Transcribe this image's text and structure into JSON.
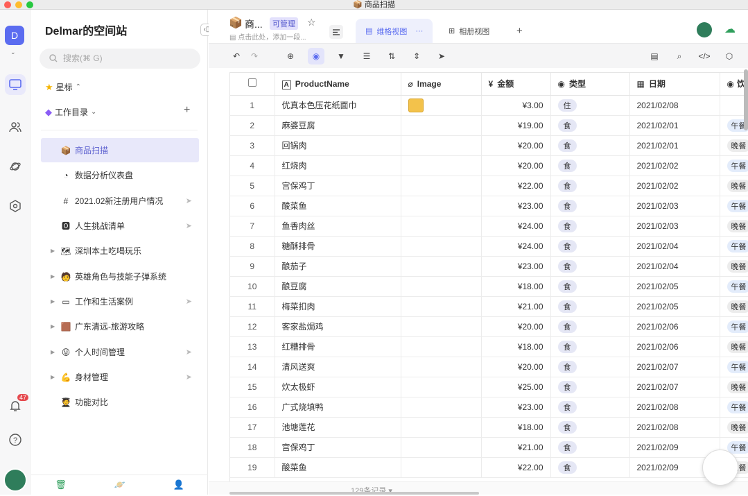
{
  "window": {
    "title": "📦 商品扫描"
  },
  "rail": {
    "workspace_initial": "D",
    "notification_count": "47"
  },
  "sidebar": {
    "title": "Delmar的空间站",
    "search_placeholder": "搜索(⌘ G)",
    "starred_label": "星标",
    "catalog_label": "工作目录",
    "items": [
      {
        "icon": "📦",
        "label": "商品扫描",
        "arrow": "",
        "active": true
      },
      {
        "icon": "◔",
        "label": "数据分析仪表盘",
        "arrow": ""
      },
      {
        "icon": "#",
        "label": "2021.02新注册用户情况",
        "arrow": ""
      },
      {
        "icon": "🅾",
        "label": "人生挑战清单",
        "arrow": ""
      },
      {
        "icon": "🗺",
        "label": "深圳本土吃喝玩乐",
        "arrow": "▶"
      },
      {
        "icon": "🧑",
        "label": "英雄角色与技能子弹系统",
        "arrow": "▶"
      },
      {
        "icon": "▭",
        "label": "工作和生活案例",
        "arrow": "▶"
      },
      {
        "icon": "🟫",
        "label": "广东清远-旅游攻略",
        "arrow": "▶"
      },
      {
        "icon": "😛",
        "label": "个人时间管理",
        "arrow": "▶"
      },
      {
        "icon": "💪",
        "label": "身材管理",
        "arrow": "▶"
      },
      {
        "icon": "🧑‍🎓",
        "label": "功能对比",
        "arrow": ""
      }
    ]
  },
  "header": {
    "doc_icon": "📦",
    "doc_title": "商...",
    "badge": "可管理",
    "desc": "点击此处，添加一段...",
    "tabs": [
      {
        "label": "维格视图"
      },
      {
        "label": "相册视图"
      }
    ],
    "add_tab": "+"
  },
  "table": {
    "columns": [
      "ProductName",
      "Image",
      "金额",
      "类型",
      "日期",
      "饮食"
    ],
    "rows": [
      {
        "n": "1",
        "name": "优真本色压花纸面巾",
        "img": true,
        "amount": "¥3.00",
        "type": "住",
        "date": "2021/02/08",
        "meal": ""
      },
      {
        "n": "2",
        "name": "麻婆豆腐",
        "amount": "¥19.00",
        "type": "食",
        "date": "2021/02/01",
        "meal": "午餐"
      },
      {
        "n": "3",
        "name": "回锅肉",
        "amount": "¥20.00",
        "type": "食",
        "date": "2021/02/01",
        "meal": "晚餐"
      },
      {
        "n": "4",
        "name": "红烧肉",
        "amount": "¥20.00",
        "type": "食",
        "date": "2021/02/02",
        "meal": "午餐"
      },
      {
        "n": "5",
        "name": "宫保鸡丁",
        "amount": "¥22.00",
        "type": "食",
        "date": "2021/02/02",
        "meal": "晚餐"
      },
      {
        "n": "6",
        "name": "酸菜鱼",
        "amount": "¥23.00",
        "type": "食",
        "date": "2021/02/03",
        "meal": "午餐"
      },
      {
        "n": "7",
        "name": "鱼香肉丝",
        "amount": "¥24.00",
        "type": "食",
        "date": "2021/02/03",
        "meal": "晚餐"
      },
      {
        "n": "8",
        "name": "糖酥排骨",
        "amount": "¥24.00",
        "type": "食",
        "date": "2021/02/04",
        "meal": "午餐"
      },
      {
        "n": "9",
        "name": "酿茄子",
        "amount": "¥23.00",
        "type": "食",
        "date": "2021/02/04",
        "meal": "晚餐"
      },
      {
        "n": "10",
        "name": "酿豆腐",
        "amount": "¥18.00",
        "type": "食",
        "date": "2021/02/05",
        "meal": "午餐"
      },
      {
        "n": "11",
        "name": "梅菜扣肉",
        "amount": "¥21.00",
        "type": "食",
        "date": "2021/02/05",
        "meal": "晚餐"
      },
      {
        "n": "12",
        "name": "客家盐焗鸡",
        "amount": "¥20.00",
        "type": "食",
        "date": "2021/02/06",
        "meal": "午餐"
      },
      {
        "n": "13",
        "name": "红糟排骨",
        "amount": "¥18.00",
        "type": "食",
        "date": "2021/02/06",
        "meal": "晚餐"
      },
      {
        "n": "14",
        "name": "清风送爽",
        "amount": "¥20.00",
        "type": "食",
        "date": "2021/02/07",
        "meal": "午餐"
      },
      {
        "n": "15",
        "name": "炊太极虾",
        "amount": "¥25.00",
        "type": "食",
        "date": "2021/02/07",
        "meal": "晚餐"
      },
      {
        "n": "16",
        "name": "广式烧填鸭",
        "amount": "¥23.00",
        "type": "食",
        "date": "2021/02/08",
        "meal": "午餐"
      },
      {
        "n": "17",
        "name": "池塘莲花",
        "amount": "¥18.00",
        "type": "食",
        "date": "2021/02/08",
        "meal": "晚餐"
      },
      {
        "n": "18",
        "name": "宫保鸡丁",
        "amount": "¥21.00",
        "type": "食",
        "date": "2021/02/09",
        "meal": "午餐"
      },
      {
        "n": "19",
        "name": "酸菜鱼",
        "amount": "¥22.00",
        "type": "食",
        "date": "2021/02/09",
        "meal": "晚餐"
      }
    ]
  },
  "footer": {
    "record_count": "129条记录 ▾"
  },
  "colors": {
    "accent": "#5b6cf0",
    "lunch_tag": "#e3ecfb",
    "dinner_tag": "#ececec"
  }
}
